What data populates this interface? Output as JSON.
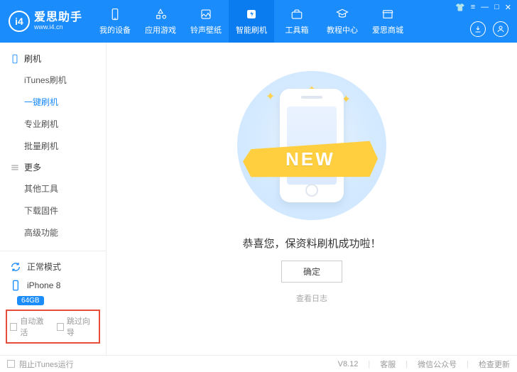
{
  "brand": {
    "cn": "爱思助手",
    "en": "www.i4.cn",
    "logo_text": "i4"
  },
  "nav": [
    {
      "label": "我的设备"
    },
    {
      "label": "应用游戏"
    },
    {
      "label": "铃声壁纸"
    },
    {
      "label": "智能刷机"
    },
    {
      "label": "工具箱"
    },
    {
      "label": "教程中心"
    },
    {
      "label": "爱思商城"
    }
  ],
  "sidebar": {
    "group1_title": "刷机",
    "group1_items": [
      "iTunes刷机",
      "一键刷机",
      "专业刷机",
      "批量刷机"
    ],
    "group2_title": "更多",
    "group2_items": [
      "其他工具",
      "下载固件",
      "高级功能"
    ]
  },
  "mode": {
    "label": "正常模式"
  },
  "device": {
    "name": "iPhone 8",
    "storage": "64GB"
  },
  "checks": {
    "auto_activate": "自动激活",
    "skip_wizard": "跳过向导"
  },
  "main": {
    "ribbon": "NEW",
    "success": "恭喜您，保资料刷机成功啦！",
    "ok": "确定",
    "view_log": "查看日志"
  },
  "status": {
    "block_itunes": "阻止iTunes运行",
    "version": "V8.12",
    "support": "客服",
    "wechat": "微信公众号",
    "check_update": "检查更新"
  }
}
